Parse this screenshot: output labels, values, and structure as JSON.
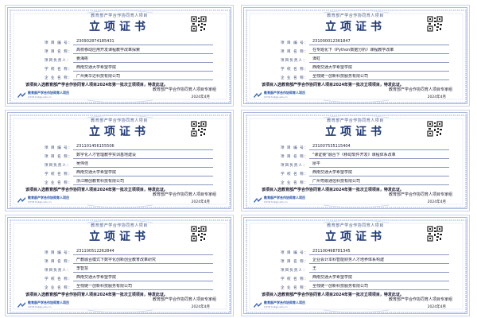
{
  "certificates": [
    {
      "issuer_top": "教育部产学合作协同育人项目",
      "title": "立项证书",
      "labels": {
        "id": "项 目 编 号：",
        "name": "项 目 名 称：",
        "leader": "项目负责人：",
        "school": "学 校 名 称：",
        "company": "企 业 名 称："
      },
      "id": "230902874185431",
      "name": "高校移动应用开发课程教学改革探索",
      "leader": "姜海彬",
      "school": "西南交通大学希望学院",
      "company": "广州美华达科技有限公司",
      "statement": "该项目入选教育部产学合作协同育人项目2024年第一批次立项项目，特发此证。",
      "logo_cn": "教育部产学合作协同育人项目",
      "logo_en": "CXYR.hnbgn.edu.cn",
      "sign_org": "教育部产学合作协同育人项目专家组",
      "sign_date": "2024年4月"
    },
    {
      "issuer_top": "教育部产学合作协同育人项目",
      "title": "立项证书",
      "labels": {
        "id": "项 目 编 号：",
        "name": "项 目 名 称：",
        "leader": "项目负责人：",
        "school": "学 校 名 称：",
        "company": "企 业 名 称："
      },
      "id": "231000012361847",
      "name": "在专题化下《Python数据分析》课程教学改革",
      "leader": "谭虹",
      "school": "西南交通大学希望学院",
      "company": "全栈链一创新科技服务有限公司",
      "statement": "该项目入选教育部产学合作协同育人项目2024年第一批次立项项目，特发此证。",
      "logo_cn": "教育部产学合作协同育人项目",
      "logo_en": "CXYR.hnbgn.edu.cn",
      "sign_org": "教育部产学合作协同育人项目专家组",
      "sign_date": "2024年4月"
    },
    {
      "issuer_top": "教育部产学合作协同育人项目",
      "title": "立项证书",
      "labels": {
        "id": "项 目 编 号：",
        "name": "项 目 名 称：",
        "leader": "项目负责人：",
        "school": "学 校 名 称：",
        "company": "企 业 名 称："
      },
      "id": "231101456155506",
      "name": "数字化人才管理教学实训基地建设",
      "leader": "吴伟佳",
      "school": "西南交通大学希望学院",
      "company": "浙江精创教育科技有限公司",
      "statement": "该项目入选教育部产学合作协同育人项目2024年第一批次立项项目，特发此证。",
      "logo_cn": "教育部产学合作协同育人项目",
      "logo_en": "CXYR.hnbgn.edu.cn",
      "sign_org": "教育部产学合作协同育人项目专家组",
      "sign_date": "2024年4月"
    },
    {
      "issuer_top": "教育部产学合作协同育人项目",
      "title": "立项证书",
      "labels": {
        "id": "项 目 编 号：",
        "name": "项 目 名 称：",
        "leader": "项目负责人：",
        "school": "学 校 名 称：",
        "company": "企 业 名 称："
      },
      "id": "231007535115404",
      "name": "\"课证赛\"融合下《移动软件开发》课程体系改革",
      "leader": "廖平",
      "school": "西南交通大学希望学院",
      "company": "广州粤嵌通信科技有限公司",
      "statement": "该项目入选教育部产学合作协同育人项目2024年第一批次立项项目，特发此证。",
      "logo_cn": "教育部产学合作协同育人项目",
      "logo_en": "CXYR.hnbgn.edu.cn",
      "sign_org": "教育部产学合作协同育人项目专家组",
      "sign_date": "2024年4月"
    },
    {
      "issuer_top": "教育部产学合作协同育人项目",
      "title": "立项证书",
      "labels": {
        "id": "项 目 编 号：",
        "name": "项 目 名 称：",
        "leader": "项目负责人：",
        "school": "学 校 名 称：",
        "company": "企 业 名 称："
      },
      "id": "231100512262844",
      "name": "产教融合模式下数字化创新创业教育改革研究",
      "leader": "李智慧",
      "school": "西南交通大学希望学院",
      "company": "全栈链一创新科技服务有限公司",
      "statement": "该项目入选教育部产学合作协同育人项目2024年第一批次立项项目，特发此证。",
      "logo_cn": "教育部产学合作协同育人项目",
      "logo_en": "CXYR.hnbgn.edu.cn",
      "sign_org": "教育部产学合作协同育人项目专家组",
      "sign_date": "2024年4月"
    },
    {
      "issuer_top": "教育部产学合作协同育人项目",
      "title": "立项证书",
      "labels": {
        "id": "项 目 编 号：",
        "name": "项 目 名 称：",
        "leader": "项目负责人：",
        "school": "学 校 名 称：",
        "company": "企 业 名 称："
      },
      "id": "231100498781345",
      "name": "企业会计本科智能财务人才培养体系构建",
      "leader": "王",
      "school": "西南交通大学希望学院",
      "company": "全栈链一创新科技服务有限公司",
      "statement": "该项目入选教育部产学合作协同育人项目2024年第一批次立项项目，特发此证。",
      "logo_cn": "教育部产学合作协同育人项目",
      "logo_en": "CXYR.hnbgn.edu.cn",
      "sign_org": "教育部产学合作协同育人项目专家组",
      "sign_date": "2024年4月"
    }
  ],
  "colors": {
    "border": "#aab8dc",
    "title": "#1f3a7a",
    "guilloche": "#c9d3ee"
  }
}
